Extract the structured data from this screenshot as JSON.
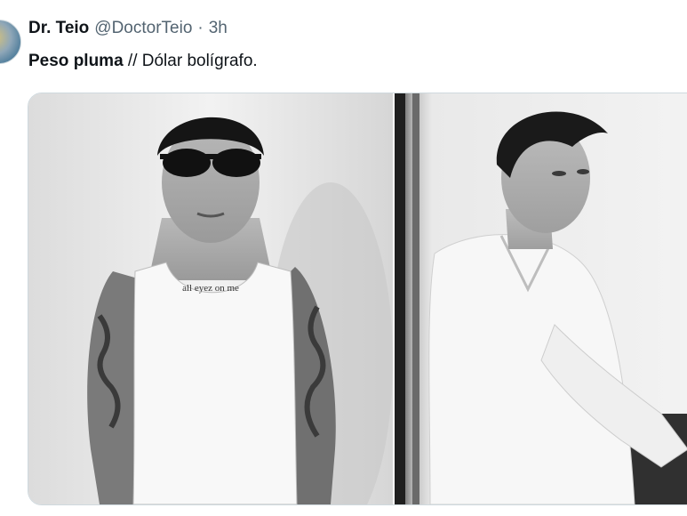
{
  "tweet": {
    "author_name": "Dr. Teio",
    "handle": "@DoctorTeio",
    "separator": "·",
    "time": "3h",
    "text_bold": "Peso pluma",
    "text_rest": " // Dólar bolígrafo."
  },
  "media": {
    "left_photo": {
      "tattoo_text": "all eyez on me",
      "icon": "person-tank-top-photo"
    },
    "right_photo": {
      "icon": "person-white-shirt-photo"
    }
  },
  "colors": {
    "text": "#0f1419",
    "secondary": "#536471",
    "border": "#cfd9de"
  }
}
